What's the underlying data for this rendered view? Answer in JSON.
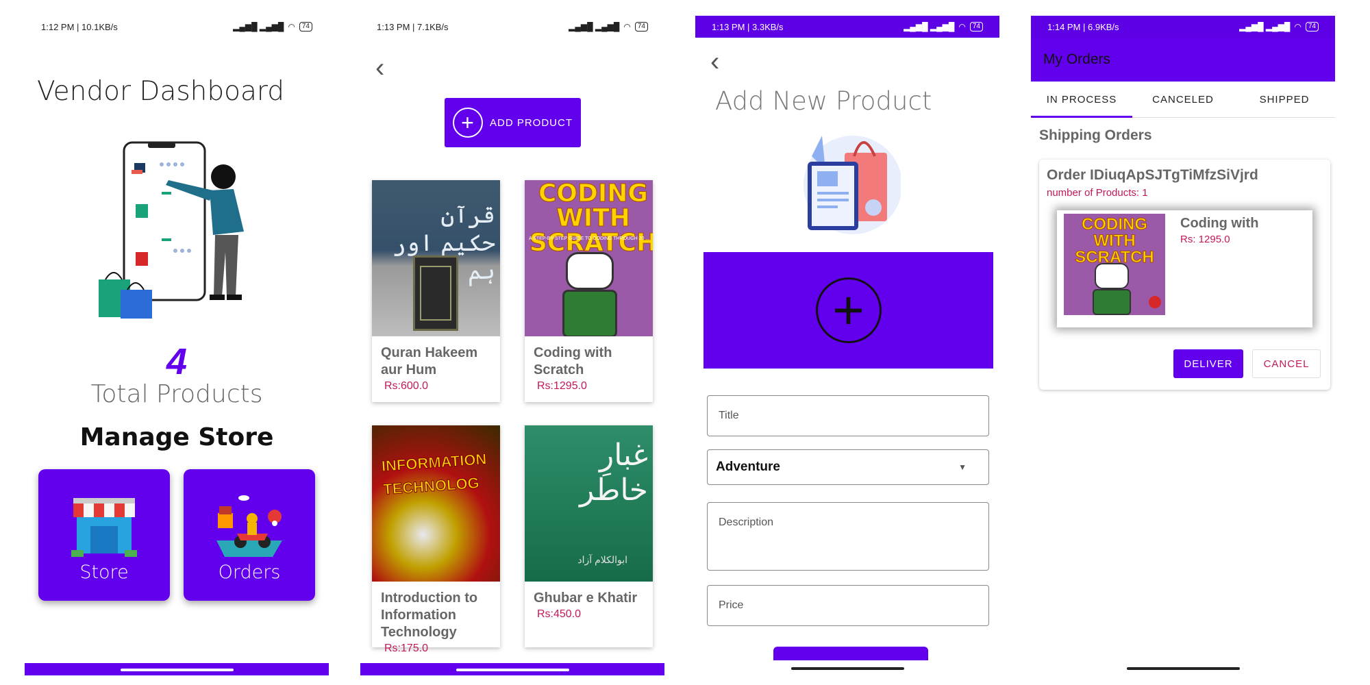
{
  "screen1": {
    "status": {
      "time": "1:12 PM | 10.1KB/s",
      "battery": "74"
    },
    "title": "Vendor Dashboard",
    "product_count": "4",
    "total_label": "Total Products",
    "manage_label": "Manage Store",
    "tiles": [
      {
        "label": "Store",
        "icon": "store-icon"
      },
      {
        "label": "Orders",
        "icon": "delivery-icon"
      }
    ]
  },
  "screen2": {
    "status": {
      "time": "1:13 PM | 7.1KB/s",
      "battery": "74"
    },
    "add_button": "ADD PRODUCT",
    "products": [
      {
        "title": "Quran Hakeem aur Hum",
        "price": "Rs:600.0",
        "cover_text": "قرآن حکیم اور ہم"
      },
      {
        "title": "Coding with Scratch",
        "price": "Rs:1295.0",
        "cover_text": "CODING WITH SCRATCH",
        "cover_sub": "A STEP-BY-STEP GUIDE TO CODING THROUGH 20 ..."
      },
      {
        "title": "Introduction to Information Technology",
        "price": "Rs:175.0",
        "cover_text": "INFORMATION TECHNOLOG"
      },
      {
        "title": "Ghubar e Khatir",
        "price": "Rs:450.0",
        "cover_text": "غبارِ خاطر",
        "cover_sub": "ابوالکلام آزاد"
      }
    ]
  },
  "screen3": {
    "status": {
      "time": "1:13 PM | 3.3KB/s",
      "battery": "74"
    },
    "title": "Add New Product",
    "fields": {
      "title_placeholder": "Title",
      "category_value": "Adventure",
      "description_placeholder": "Description",
      "price_placeholder": "Price"
    }
  },
  "screen4": {
    "status": {
      "time": "1:14 PM | 6.9KB/s",
      "battery": "74"
    },
    "appbar_title": "My Orders",
    "tabs": [
      "IN PROCESS",
      "CANCELED",
      "SHIPPED"
    ],
    "section_title": "Shipping Orders",
    "order": {
      "id": "Order IDiuqApSJTgTiMfzSiVjrd",
      "count": "number of Products: 1",
      "item_title": "Coding with",
      "item_price": "Rs: 1295.0",
      "cover_text": "CODING WITH SCRATCH"
    },
    "deliver_label": "DELIVER",
    "cancel_label": "CANCEL"
  },
  "colors": {
    "primary": "#6200ee",
    "price": "#c2185b"
  }
}
